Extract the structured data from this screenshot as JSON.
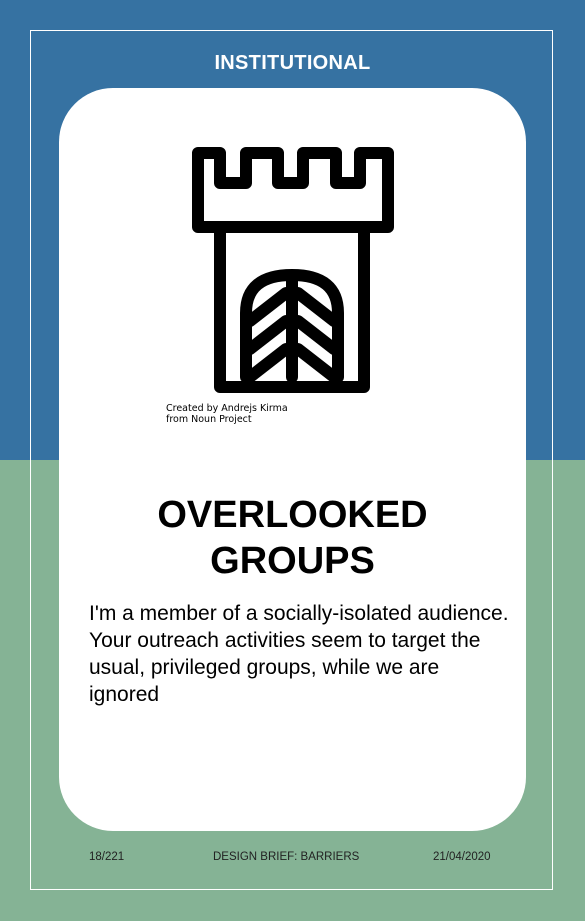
{
  "colors": {
    "top_background": "#3672a2",
    "bottom_background": "#85b395",
    "card_background": "#ffffff",
    "frame_line": "#ffffff"
  },
  "card": {
    "category": "INSTITUTIONAL",
    "icon": "castle-tower-icon",
    "icon_credit_line1": "Created by Andrejs Kirma",
    "icon_credit_line2": "from Noun Project",
    "title_line1": "OVERLOOKED",
    "title_line2": "GROUPS",
    "description": "I'm a member of a socially-isolated audience. Your outreach activities seem to target the usual, privileged groups, while we are ignored"
  },
  "footer": {
    "page": "18/221",
    "label": "DESIGN BRIEF: BARRIERS",
    "date": "21/04/2020"
  }
}
